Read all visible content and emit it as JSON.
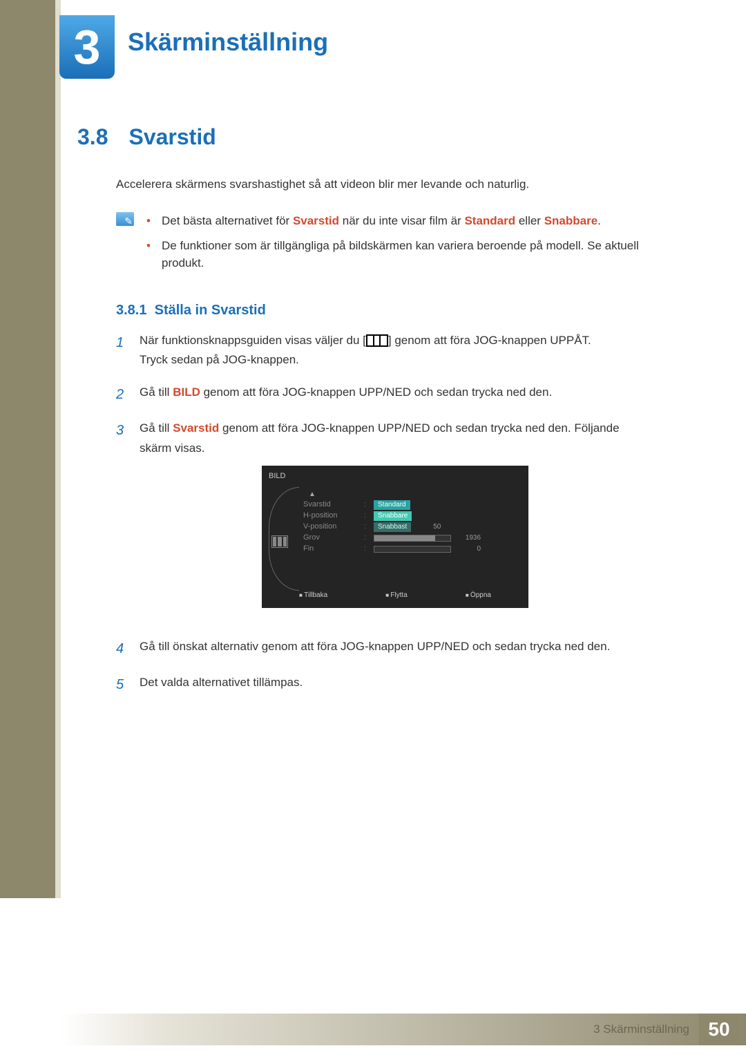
{
  "chapter": {
    "number": "3",
    "title": "Skärminställning"
  },
  "section": {
    "number": "3.8",
    "title": "Svarstid"
  },
  "intro": "Accelerera skärmens svarshastighet så att videon blir mer levande och naturlig.",
  "notes": {
    "item1": {
      "pre": "Det bästa alternativet för ",
      "kw1": "Svarstid",
      "mid": " när du inte visar film är ",
      "kw2": "Standard",
      "join": " eller ",
      "kw3": "Snabbare",
      "post": "."
    },
    "item2": "De funktioner som är tillgängliga på bildskärmen kan variera beroende på modell. Se aktuell produkt."
  },
  "subsection": {
    "number": "3.8.1",
    "title": "Ställa in Svarstid"
  },
  "steps": {
    "s1": {
      "a": "När funktionsknappsguiden visas väljer du [",
      "b": "] genom att föra JOG-knappen UPPÅT.",
      "c": "Tryck sedan på JOG-knappen."
    },
    "s2": {
      "a": "Gå till ",
      "kw": "BILD",
      "b": " genom att föra JOG-knappen UPP/NED och sedan trycka ned den."
    },
    "s3": {
      "a": "Gå till ",
      "kw": "Svarstid",
      "b": " genom att föra JOG-knappen UPP/NED och sedan trycka ned den. Följande skärm visas."
    },
    "s4": "Gå till önskat alternativ genom att föra JOG-knappen UPP/NED och sedan trycka ned den.",
    "s5": "Det valda alternativet tillämpas."
  },
  "osd": {
    "title": "BILD",
    "rows": {
      "svarstid": "Svarstid",
      "hpos": "H-position",
      "vpos": "V-position",
      "grov": "Grov",
      "fin": "Fin"
    },
    "options": {
      "standard": "Standard",
      "snabbare": "Snabbare",
      "snabbast": "Snabbast"
    },
    "values": {
      "vpos": "50",
      "grov": "1936",
      "fin": "0"
    },
    "footer": {
      "back": "Tillbaka",
      "move": "Flytta",
      "open": "Öppna"
    }
  },
  "chart_data": {
    "type": "table",
    "title": "BILD OSD menu",
    "rows": [
      {
        "label": "Svarstid",
        "options": [
          "Standard",
          "Snabbare",
          "Snabbast"
        ],
        "selected": "Snabbare"
      },
      {
        "label": "H-position",
        "value": null
      },
      {
        "label": "V-position",
        "value": 50
      },
      {
        "label": "Grov",
        "value": 1936
      },
      {
        "label": "Fin",
        "value": 0
      }
    ]
  },
  "footer": {
    "label": "3 Skärminställning",
    "page": "50"
  }
}
